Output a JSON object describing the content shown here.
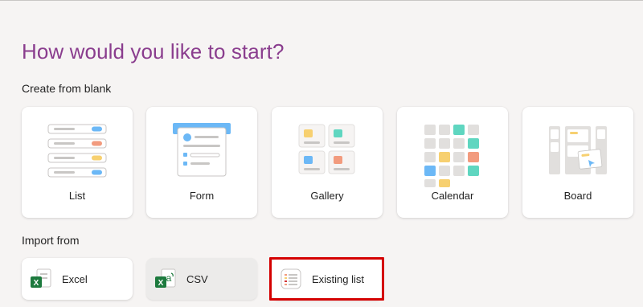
{
  "header": {
    "title": "How would you like to start?"
  },
  "create_section": {
    "label": "Create from blank",
    "cards": [
      {
        "label": "List",
        "icon": "list-template-icon"
      },
      {
        "label": "Form",
        "icon": "form-template-icon"
      },
      {
        "label": "Gallery",
        "icon": "gallery-template-icon"
      },
      {
        "label": "Calendar",
        "icon": "calendar-template-icon"
      },
      {
        "label": "Board",
        "icon": "board-template-icon"
      }
    ]
  },
  "import_section": {
    "label": "Import from",
    "cards": [
      {
        "label": "Excel",
        "icon": "excel-icon"
      },
      {
        "label": "CSV",
        "icon": "csv-icon"
      },
      {
        "label": "Existing list",
        "icon": "existing-list-icon"
      }
    ]
  },
  "colors": {
    "title": "#8a3d8e",
    "highlight": "#d40000",
    "accent_blue": "#6cb8f6",
    "accent_orange": "#f29b7e",
    "accent_yellow": "#f7d070",
    "accent_teal": "#5fd6c0"
  }
}
